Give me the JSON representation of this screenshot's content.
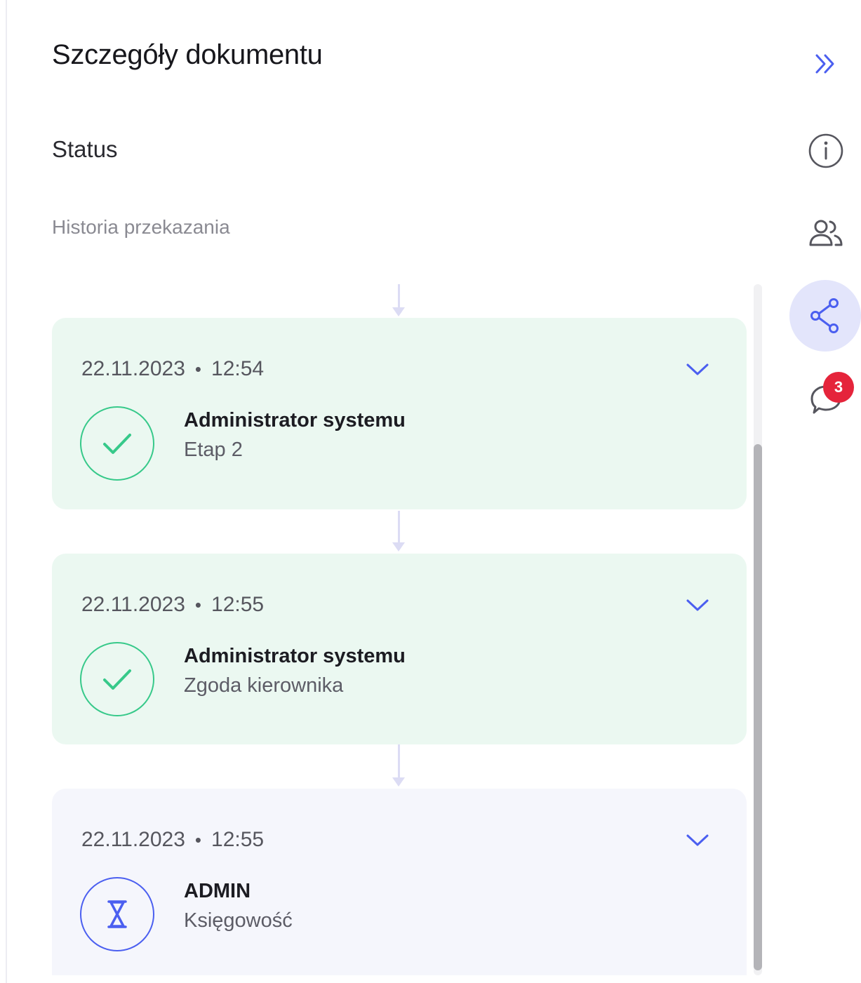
{
  "panel": {
    "title": "Szczegóły dokumentu",
    "status_label": "Status",
    "history_label": "Historia przekazania"
  },
  "history": [
    {
      "date": "22.11.2023",
      "separator": "•",
      "time": "12:54",
      "user": "Administrator systemu",
      "step": "Etap 2",
      "state": "completed",
      "state_icon": "check-icon"
    },
    {
      "date": "22.11.2023",
      "separator": "•",
      "time": "12:55",
      "user": "Administrator systemu",
      "step": "Zgoda kierownika",
      "state": "completed",
      "state_icon": "check-icon"
    },
    {
      "date": "22.11.2023",
      "separator": "•",
      "time": "12:55",
      "user": "ADMIN",
      "step": "Księgowość",
      "state": "pending",
      "state_icon": "hourglass-icon"
    }
  ],
  "rail": {
    "items": [
      {
        "icon": "double-chevron-right-icon",
        "active": false
      },
      {
        "icon": "info-icon",
        "active": false
      },
      {
        "icon": "users-icon",
        "active": false
      },
      {
        "icon": "share-icon",
        "active": true
      },
      {
        "icon": "comment-icon",
        "active": false,
        "badge": "3"
      }
    ]
  },
  "colors": {
    "accent": "#4b5ff0",
    "completed": "#37c98a",
    "completed_bg": "#ebf8f1",
    "pending_bg": "#f5f6fc",
    "badge": "#e5243b"
  }
}
